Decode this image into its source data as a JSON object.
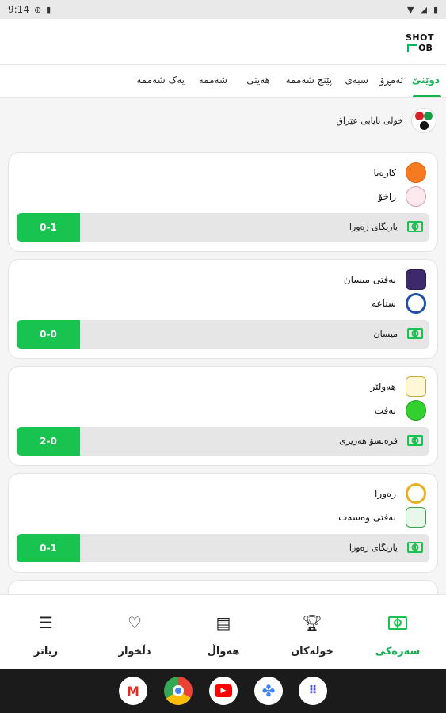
{
  "status_bar": {
    "time": "9:14"
  },
  "header": {
    "logo_top": "SHOT",
    "logo_bottom": "OB"
  },
  "day_tabs": [
    {
      "label": "دوێنێ",
      "active": true
    },
    {
      "label": "ئەمڕۆ"
    },
    {
      "label": "سبەی"
    },
    {
      "label": "پێنج شەممە"
    },
    {
      "label": "هەینی"
    },
    {
      "label": "شەممە"
    },
    {
      "label": "یەک شەممە"
    }
  ],
  "league": {
    "name": "خولی نایابی عێراق"
  },
  "matches": [
    {
      "home": "کارەبا",
      "away": "زاخۆ",
      "score": "0-1",
      "venue": "یاریگای زەورا"
    },
    {
      "home": "نەفتی میسان",
      "away": "سناعە",
      "score": "0-0",
      "venue": "میسان"
    },
    {
      "home": "هەولێر",
      "away": "نەفت",
      "score": "2-0",
      "venue": "فرەنسۆ هەریری"
    },
    {
      "home": "زەورا",
      "away": "نەفتی وەسەت",
      "score": "0-1",
      "venue": "یاریگای زەورا"
    }
  ],
  "bottom_nav": {
    "scores": "سەرەکی",
    "leagues": "خولەکان",
    "news": "هەواڵ",
    "favorites": "دڵخواز",
    "more": "زیاتر"
  },
  "dock": [
    "gmail-icon",
    "chrome-icon",
    "youtube-icon",
    "photos-icon",
    "apps-icon"
  ],
  "colors": {
    "accent": "#14b24f",
    "score_bg": "#18c44f"
  }
}
